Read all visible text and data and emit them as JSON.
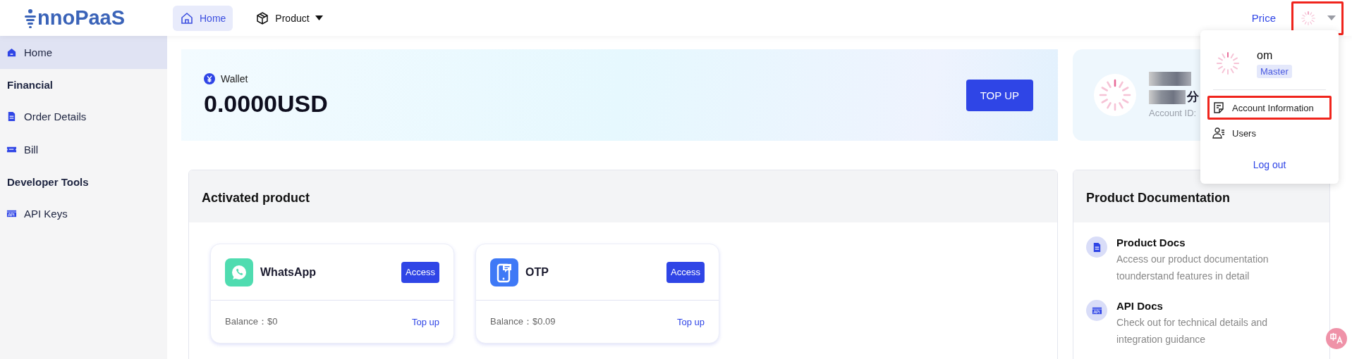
{
  "header": {
    "logo": "nnoPaaS",
    "nav": [
      {
        "label": "Home",
        "kind": "home",
        "selected": true
      },
      {
        "label": "Product",
        "kind": "product",
        "selected": false
      }
    ],
    "price": "Price",
    "avatar_highlighted": true
  },
  "sidebar": {
    "items": [
      {
        "kind": "home",
        "label": "Home",
        "selected": true
      },
      {
        "kind": "heading",
        "label": "Financial"
      },
      {
        "kind": "orders",
        "label": "Order Details",
        "selected": false
      },
      {
        "kind": "bill",
        "label": "Bill",
        "selected": false
      },
      {
        "kind": "heading",
        "label": "Developer Tools"
      },
      {
        "kind": "keys",
        "label": "API Keys",
        "selected": false
      }
    ]
  },
  "wallet": {
    "label": "Wallet",
    "amount": "0.0000USD",
    "button": "TOP UP"
  },
  "account": {
    "name_part": "分",
    "id_label": "Account ID:"
  },
  "activated": {
    "title": "Activated product",
    "products": [
      {
        "name": "WhatsApp",
        "kind": "chat",
        "button": "Access",
        "balance": "Balance：$0",
        "link": "Top up"
      },
      {
        "name": "OTP",
        "kind": "sms",
        "button": "Access",
        "balance": "Balance：$0.09",
        "link": "Top up"
      }
    ]
  },
  "docs": {
    "title": "Product Documentation",
    "items": [
      {
        "title": "Product Docs",
        "kind": "product",
        "text": "Access our product documentation tounderstand features in detail"
      },
      {
        "title": "API Docs",
        "kind": "api",
        "text": "Check out for technical details and integration guidance"
      }
    ]
  },
  "user_menu": {
    "name": "om",
    "role": "Master",
    "items": [
      {
        "label": "Account Information",
        "kind": "account",
        "highlighted": true
      },
      {
        "label": "Users",
        "kind": "users",
        "highlighted": false
      }
    ],
    "logout": "Log out"
  }
}
